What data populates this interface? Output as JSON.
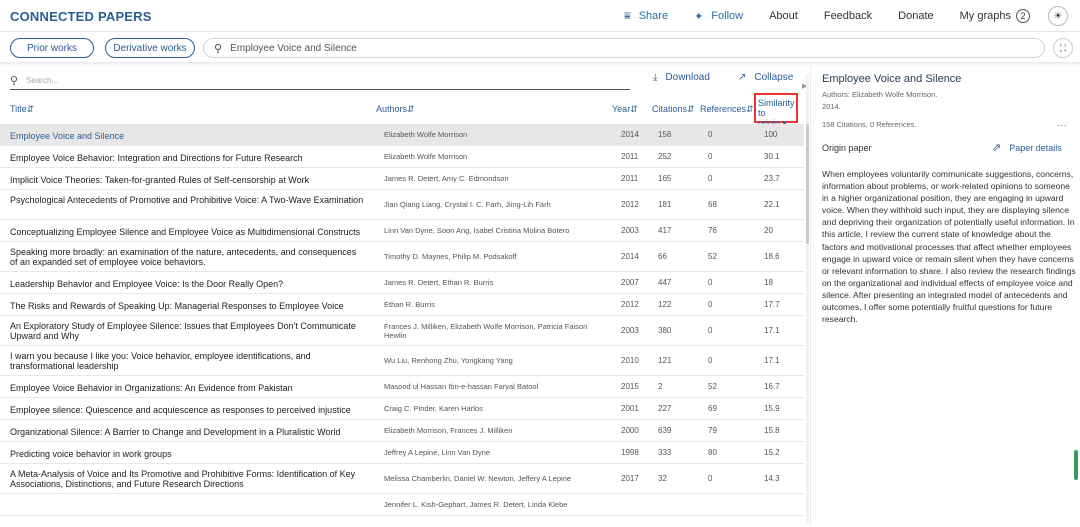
{
  "header": {
    "brand": "CONNECTED PAPERS",
    "nav": [
      {
        "label": "Share",
        "icon": "share-icon"
      },
      {
        "label": "Follow",
        "icon": "twitter-icon"
      },
      {
        "label": "About"
      },
      {
        "label": "Feedback"
      },
      {
        "label": "Donate"
      },
      {
        "label": "My graphs",
        "badge": "2"
      }
    ],
    "theme_icon": "sun-icon"
  },
  "toolbar": {
    "prior_works": "Prior works",
    "derivative_works": "Derivative works",
    "search_value": "Employee Voice and Silence"
  },
  "table": {
    "search_placeholder": "Search...",
    "download": "Download",
    "collapse": "Collapse",
    "columns": {
      "title": "Title",
      "authors": "Authors",
      "year": "Year",
      "citations": "Citations",
      "references": "References",
      "similarity_1": "Similarity",
      "similarity_2": "to origin"
    },
    "rows": [
      {
        "title": "Employee Voice and Silence",
        "authors": "Elizabeth Wolfe Morrison",
        "year": "2014",
        "citations": "158",
        "references": "0",
        "similarity": "100"
      },
      {
        "title": "Employee Voice Behavior: Integration and Directions for Future Research",
        "authors": "Elizabeth Wolfe Morrison",
        "year": "2011",
        "citations": "252",
        "references": "0",
        "similarity": "30.1"
      },
      {
        "title": "Implicit Voice Theories: Taken-for-granted Rules of Self-censorship at Work",
        "authors": "James R. Detert, Amy C. Edmondson",
        "year": "2011",
        "citations": "165",
        "references": "0",
        "similarity": "23.7"
      },
      {
        "title": "Psychological Antecedents of Promotive and Prohibitive Voice: A Two-Wave Examination",
        "authors": "Jian Qiang Liang, Crystal I. C. Farh, Jiing-Lih Farh",
        "year": "2012",
        "citations": "181",
        "references": "68",
        "similarity": "22.1"
      },
      {
        "title": "Conceptualizing Employee Silence and Employee Voice as Multidimensional Constructs",
        "authors": "Linn Van Dyne, Soon Ang, Isabel Cristina Molina Botero",
        "year": "2003",
        "citations": "417",
        "references": "76",
        "similarity": "20"
      },
      {
        "title": "Speaking more broadly: an examination of the nature, antecedents, and consequences of an expanded set of employee voice behaviors.",
        "authors": "Timothy D. Maynes, Philip M. Podsakoff",
        "year": "2014",
        "citations": "66",
        "references": "52",
        "similarity": "18.6"
      },
      {
        "title": "Leadership Behavior and Employee Voice: Is the Door Really Open?",
        "authors": "James R. Detert, Ethan R. Burris",
        "year": "2007",
        "citations": "447",
        "references": "0",
        "similarity": "18"
      },
      {
        "title": "The Risks and Rewards of Speaking Up: Managerial Responses to Employee Voice",
        "authors": "Ethan R. Burris",
        "year": "2012",
        "citations": "122",
        "references": "0",
        "similarity": "17.7"
      },
      {
        "title": "An Exploratory Study of Employee Silence: Issues that Employees Don't Communicate Upward and Why",
        "authors": "Frances J. Milliken, Elizabeth Wolfe Morrison, Patricia Faison Hewlin",
        "year": "2003",
        "citations": "380",
        "references": "0",
        "similarity": "17.1"
      },
      {
        "title": "I warn you because I like you: Voice behavior, employee identifications, and transformational leadership",
        "authors": "Wu Liu, Renhong Zhu, Yongkang Yang",
        "year": "2010",
        "citations": "121",
        "references": "0",
        "similarity": "17.1"
      },
      {
        "title": "Employee Voice Behavior in Organizations: An Evidence from Pakistan",
        "authors": "Masood ul Hassan Ibn-e-hassan Faryal Batool",
        "year": "2015",
        "citations": "2",
        "references": "52",
        "similarity": "16.7"
      },
      {
        "title": "Employee silence: Quiescence and acquiescence as responses to perceived injustice",
        "authors": "Craig C. Pinder, Karen Harlos",
        "year": "2001",
        "citations": "227",
        "references": "69",
        "similarity": "15.9"
      },
      {
        "title": "Organizational Silence: A Barrier to Change and Development in a Pluralistic World",
        "authors": "Elizabeth Morrison, Frances J. Milliken",
        "year": "2000",
        "citations": "639",
        "references": "79",
        "similarity": "15.8"
      },
      {
        "title": "Predicting voice behavior in work groups",
        "authors": "Jeffrey A Lepine, Linn Van Dyne",
        "year": "1998",
        "citations": "333",
        "references": "80",
        "similarity": "15.2"
      },
      {
        "title": "A Meta-Analysis of Voice and Its Promotive and Prohibitive Forms: Identification of Key Associations, Distinctions, and Future Research Directions",
        "authors": "Melissa Chamberlin, Daniel W. Newton, Jeffery A Lepine",
        "year": "2017",
        "citations": "32",
        "references": "0",
        "similarity": "14.3"
      },
      {
        "title": "",
        "authors": "Jennifer L. Kish-Gephart, James R. Detert, Linda Klebe",
        "year": "",
        "citations": "",
        "references": "",
        "similarity": ""
      }
    ]
  },
  "detail": {
    "title": "Employee Voice and Silence",
    "authors": "Authors: Elizabeth Wolfe Morrison.",
    "year": "2014.",
    "counts": "158 Citations, 0 References.",
    "more": "...",
    "origin_label": "Origin paper",
    "paper_details": "Paper details",
    "abstract": "When employees voluntarily communicate suggestions, concerns, information about problems, or work-related opinions to someone in a higher organizational position, they are engaging in upward voice. When they withhold such input, they are displaying silence and depriving their organization of potentially useful information. In this article, I review the current state of knowledge about the factors and motivational processes that affect whether employees engage in upward voice or remain silent when they have concerns or relevant information to share. I also review the research findings on the organizational and individual effects of employee voice and silence. After presenting an integrated model of antecedents and outcomes, I offer some potentially fruitful questions for future research."
  },
  "colors": {
    "accent": "#2b5d96",
    "selected_row": "#e7e7e7",
    "highlight_box": "#ee3333"
  }
}
